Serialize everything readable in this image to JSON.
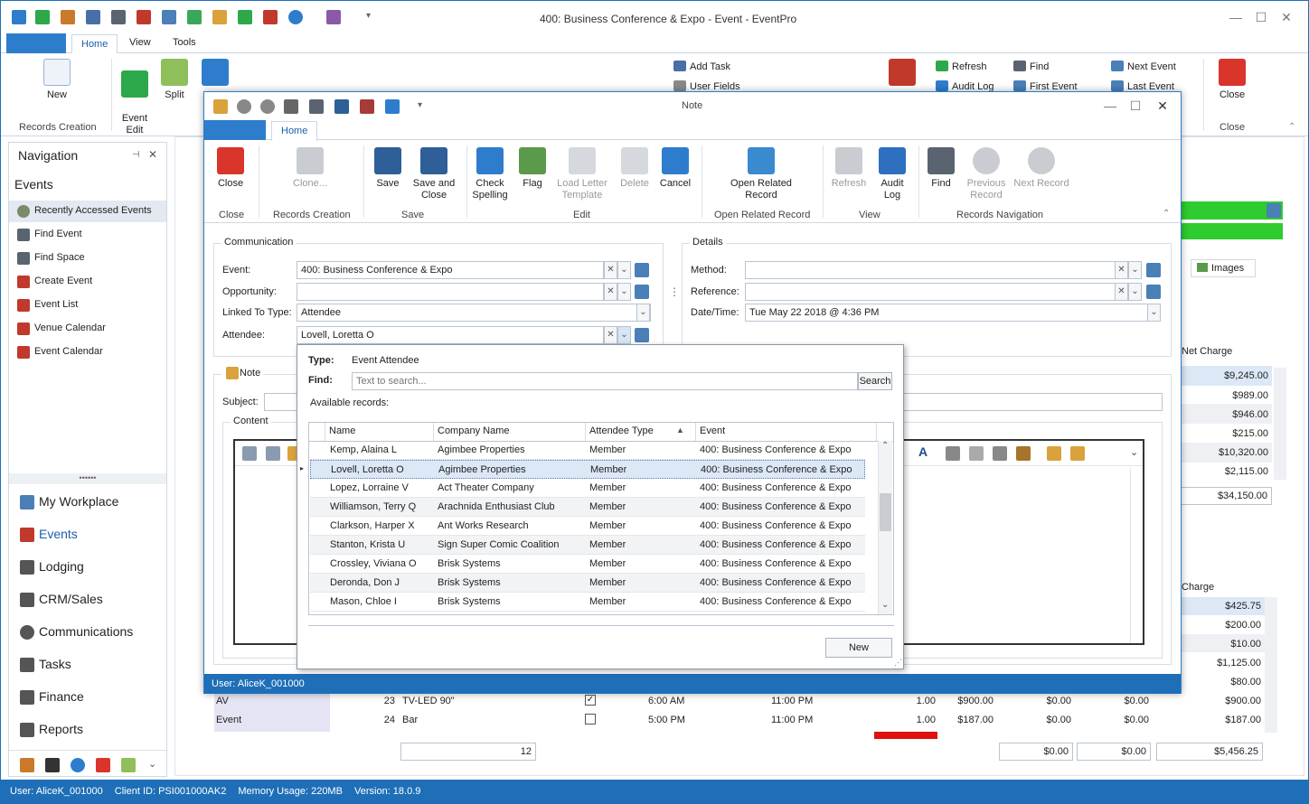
{
  "window": {
    "title": "400: Business Conference & Expo - Event - EventPro"
  },
  "tabs": {
    "home": "Home",
    "view": "View",
    "tools": "Tools"
  },
  "ribbon": {
    "new": "New",
    "event_edit": "Event\nEdit",
    "split": "Split",
    "records_creation": "Records Creation",
    "add_task": "Add Task",
    "user_fields": "User Fields",
    "refresh": "Refresh",
    "audit_log": "Audit Log",
    "find": "Find",
    "first_event": "First Event",
    "next_event": "Next Event",
    "last_event": "Last Event",
    "close": "Close",
    "close_group": "Close"
  },
  "nav": {
    "header": "Navigation",
    "section": "Events",
    "items": [
      "Recently Accessed Events",
      "Find Event",
      "Find Space",
      "Create Event",
      "Event List",
      "Venue Calendar",
      "Event Calendar"
    ],
    "modules": [
      "My Workplace",
      "Events",
      "Lodging",
      "CRM/Sales",
      "Communications",
      "Tasks",
      "Finance",
      "Reports"
    ]
  },
  "background": {
    "images_tab": "Images",
    "net_charge_header": "Net Charge",
    "net_charges": [
      "$9,245.00",
      "$989.00",
      "$946.00",
      "$215.00",
      "$10,320.00",
      "$2,115.00"
    ],
    "net_total": "$34,150.00",
    "charge_header": "Charge",
    "charges": [
      "$425.75",
      "$200.00",
      "$10.00",
      "$1,125.00",
      "$80.00"
    ],
    "rows": [
      {
        "type": "AV",
        "qty": "23",
        "item": "TV-LED 90\"",
        "checked": true,
        "start": "6:00 AM",
        "end": "11:00 PM",
        "num": "1.00",
        "price": "$900.00",
        "a": "$0.00",
        "b": "$0.00",
        "total": "$900.00"
      },
      {
        "type": "Event",
        "qty": "24",
        "item": "Bar",
        "checked": false,
        "start": "5:00 PM",
        "end": "11:00 PM",
        "num": "1.00",
        "price": "$187.00",
        "a": "$0.00",
        "b": "$0.00",
        "total": "$187.00"
      }
    ],
    "footer_count": "12",
    "footer_a": "$0.00",
    "footer_b": "$0.00",
    "footer_total": "$5,456.25"
  },
  "status": {
    "user": "User: AliceK_001000",
    "client": "Client ID: PSI001000AK2",
    "memory": "Memory Usage: 220MB",
    "version": "Version: 18.0.9"
  },
  "dialog": {
    "title": "Note",
    "home_tab": "Home",
    "buttons": {
      "close": "Close",
      "clone": "Clone...",
      "save": "Save",
      "save_close": "Save and\nClose",
      "check_spelling": "Check\nSpelling",
      "flag": "Flag",
      "load_letter": "Load Letter\nTemplate",
      "delete": "Delete",
      "cancel": "Cancel",
      "open_related": "Open Related\nRecord",
      "refresh": "Refresh",
      "audit_log": "Audit\nLog",
      "find": "Find",
      "previous_record": "Previous\nRecord",
      "next_record": "Next Record"
    },
    "groups": {
      "close": "Close",
      "records_creation": "Records Creation",
      "save": "Save",
      "edit": "Edit",
      "open_related": "Open Related Record",
      "view": "View",
      "navigation": "Records Navigation"
    },
    "communication": {
      "title": "Communication",
      "event_label": "Event:",
      "event_value": "400: Business Conference & Expo",
      "opportunity_label": "Opportunity:",
      "opportunity_value": "",
      "linked_label": "Linked To Type:",
      "linked_value": "Attendee",
      "attendee_label": "Attendee:",
      "attendee_value": "Lovell, Loretta O"
    },
    "details": {
      "title": "Details",
      "method_label": "Method:",
      "method_value": "",
      "reference_label": "Reference:",
      "reference_value": "",
      "datetime_label": "Date/Time:",
      "datetime_value": "Tue May 22 2018 @ 4:36 PM"
    },
    "note": {
      "title": "Note",
      "subject_label": "Subject:",
      "content_label": "Content"
    },
    "status": "User: AliceK_001000"
  },
  "popup": {
    "type_label": "Type:",
    "type_value": "Event Attendee",
    "find_label": "Find:",
    "search_placeholder": "Text to search...",
    "search_button": "Search",
    "available": "Available records:",
    "columns": [
      "Name",
      "Company Name",
      "Attendee Type",
      "Event"
    ],
    "rows": [
      [
        "Kemp, Alaina L",
        "Agimbee Properties",
        "Member",
        "400: Business Conference & Expo"
      ],
      [
        "Lovell, Loretta O",
        "Agimbee Properties",
        "Member",
        "400: Business Conference & Expo"
      ],
      [
        "Lopez, Lorraine V",
        "Act Theater Company",
        "Member",
        "400: Business Conference & Expo"
      ],
      [
        "Williamson, Terry Q",
        "Arachnida Enthusiast Club",
        "Member",
        "400: Business Conference & Expo"
      ],
      [
        "Clarkson, Harper X",
        "Ant Works Research",
        "Member",
        "400: Business Conference & Expo"
      ],
      [
        "Stanton, Krista U",
        "Sign Super Comic Coalition",
        "Member",
        "400: Business Conference & Expo"
      ],
      [
        "Crossley, Viviana O",
        "Brisk Systems",
        "Member",
        "400: Business Conference & Expo"
      ],
      [
        "Deronda, Don J",
        "Brisk Systems",
        "Member",
        "400: Business Conference & Expo"
      ],
      [
        "Mason, Chloe I",
        "Brisk Systems",
        "Member",
        "400: Business Conference & Expo"
      ]
    ],
    "selected_index": 1,
    "new_button": "New"
  }
}
